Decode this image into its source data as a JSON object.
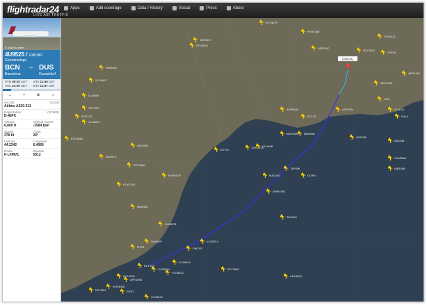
{
  "brand": {
    "name": "flightradar24",
    "tagline": "LIVE AIR TRAFFIC"
  },
  "nav": [
    {
      "label": "Apps",
      "icon": "phone-icon"
    },
    {
      "label": "Add coverage",
      "icon": "antenna-icon"
    },
    {
      "label": "Data / History",
      "icon": "database-icon"
    },
    {
      "label": "Social",
      "icon": "thumbs-up-icon"
    },
    {
      "label": "Press",
      "icon": "megaphone-icon"
    },
    {
      "label": "About",
      "icon": "info-icon"
    }
  ],
  "flight": {
    "number": "4U9525",
    "callsign": "GWI18G",
    "airline": "Germanwings",
    "photo_credit": "© Josef Lindner",
    "from_code": "BCN",
    "from_name": "Barcelona",
    "to_code": "DUS",
    "to_name": "Dusseldorf",
    "std_label": "STD",
    "std": "09:35",
    "std_tz": "CET",
    "atd_label": "ATD",
    "atd": "10:00",
    "atd_tz": "CET",
    "sta_label": "STA",
    "sta": "11:55",
    "sta_tz": "CET",
    "eta_label": "ETA",
    "eta": "11:57",
    "eta_tz": "CET",
    "progress": 0.15
  },
  "details": {
    "aircraft_label": "Aircraft",
    "aircraft_type_code": "(A320)",
    "aircraft": "Airbus A320-211",
    "registration_label": "Registration",
    "registration_code": "(3C8E9)",
    "registration": "D-AIPX",
    "altitude_label": "Altitude",
    "altitude": "6,800 ft",
    "vspeed_label": "Vertical Speed",
    "vspeed": "-3584 fpm",
    "speed_label": "Speed",
    "speed": "378 kt",
    "track_label": "Track",
    "track": "26°",
    "lat_label": "Latitude",
    "lat": "44.2342",
    "lon_label": "Longitude",
    "lon": "6.4069",
    "radar_label": "Radar",
    "radar": "F-LFMV1",
    "squawk_label": "Squawk",
    "squawk": "5512"
  },
  "map": {
    "water": "#2e4052",
    "land": "#6d6a57",
    "track_color": "#3b2ff0",
    "selected_label": "GWI18G",
    "planes": [
      {
        "t": "EZY36TP"
      },
      {
        "t": "RYR2358"
      },
      {
        "t": "TAP5572"
      },
      {
        "t": "EZY8904"
      },
      {
        "t": "AFR2MC"
      },
      {
        "t": "CRL5412"
      },
      {
        "t": "TVF40"
      },
      {
        "t": "AFR7426"
      },
      {
        "t": "VLG6407"
      },
      {
        "t": "SWR640"
      },
      {
        "t": "DLH36R"
      },
      {
        "t": "EZY4800"
      },
      {
        "t": "AEE1036"
      },
      {
        "t": "TAP7521"
      },
      {
        "t": "RYR7ZS"
      },
      {
        "t": "CLH10L"
      },
      {
        "t": "VLG8011"
      },
      {
        "t": "AFR9640"
      },
      {
        "t": "EC175"
      },
      {
        "t": "AFR7HN"
      },
      {
        "t": "CLM"
      },
      {
        "t": "DAL8"
      },
      {
        "t": "BER3000"
      },
      {
        "t": "BAW996"
      },
      {
        "t": "AZA788"
      },
      {
        "t": "AZA334"
      },
      {
        "t": "EZY58AX"
      },
      {
        "t": "BAW872"
      },
      {
        "t": "EZY1C"
      },
      {
        "t": "AFR7725"
      },
      {
        "t": "VLG4AB"
      },
      {
        "t": "CCM56W"
      },
      {
        "t": "EZY5QW"
      },
      {
        "t": "TAP496"
      },
      {
        "t": "DLH9U"
      },
      {
        "t": "AIB1098"
      },
      {
        "t": "EWG6IQ"
      },
      {
        "t": "MAC492"
      },
      {
        "t": "EZY475U"
      },
      {
        "t": "SWR1953"
      },
      {
        "t": "RYR81DF"
      },
      {
        "t": "BAW96C"
      },
      {
        "t": "TRA069"
      },
      {
        "t": "VLG8221"
      },
      {
        "t": "DLH6UP"
      },
      {
        "t": "RYR1"
      },
      {
        "t": "VLG8434"
      },
      {
        "t": "VLG5514"
      },
      {
        "t": "FIN7VE"
      },
      {
        "t": "VLG8264"
      },
      {
        "t": "EZY4C3"
      },
      {
        "t": "VLG8622"
      },
      {
        "t": "EZY2986"
      },
      {
        "t": "DAL9254"
      },
      {
        "t": "AFR1058"
      },
      {
        "t": "AEA3534"
      },
      {
        "t": "AFR4058"
      },
      {
        "t": "RYR1"
      },
      {
        "t": "EZY62N"
      },
      {
        "t": "VLG8042"
      }
    ]
  }
}
